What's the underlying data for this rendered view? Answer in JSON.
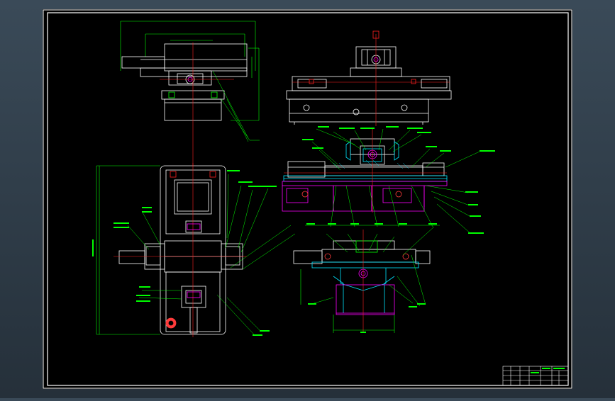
{
  "drawing": {
    "background_color": "#000000",
    "frame_color": "#ffffff",
    "part_color": "#ffffff",
    "dimension_color": "#00ff00",
    "centerline_color": "#ff2020",
    "hatch_color": "#00e5ff",
    "section_color": "#ff00ff",
    "marker_color": "#ff3b3b",
    "leader_color": "#00ff00"
  },
  "views": [
    {
      "id": "top-left-end-view"
    },
    {
      "id": "top-right-front-view"
    },
    {
      "id": "middle-right-section-view"
    },
    {
      "id": "bottom-left-plan-view"
    },
    {
      "id": "bottom-right-detail-section"
    }
  ],
  "title_block": {
    "rows": 4,
    "cols": 6
  }
}
